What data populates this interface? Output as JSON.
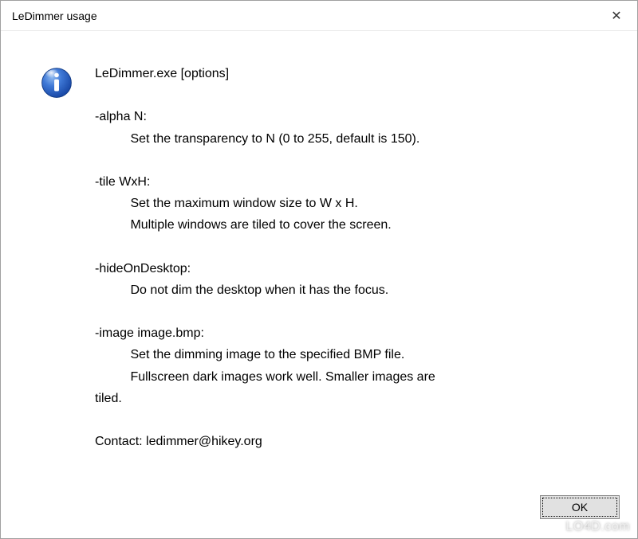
{
  "window": {
    "title": "LeDimmer usage"
  },
  "icon": {
    "name": "info-icon"
  },
  "message": {
    "lines": [
      "LeDimmer.exe [options]",
      "",
      "-alpha N:",
      "          Set the transparency to N (0 to 255, default is 150).",
      "",
      "-tile WxH:",
      "          Set the maximum window size to W x H.",
      "          Multiple windows are tiled to cover the screen.",
      "",
      "-hideOnDesktop:",
      "          Do not dim the desktop when it has the focus.",
      "",
      "-image image.bmp:",
      "          Set the dimming image to the specified BMP file.",
      "          Fullscreen dark images work well. Smaller images are",
      "tiled.",
      "",
      "Contact: ledimmer@hikey.org"
    ]
  },
  "buttons": {
    "ok": "OK"
  },
  "watermark": "LO4D.com"
}
